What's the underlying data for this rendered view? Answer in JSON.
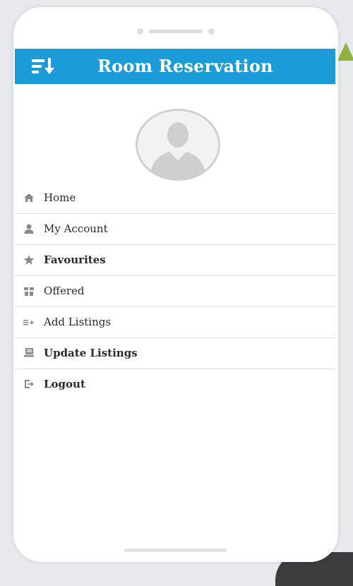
{
  "app": {
    "title": "Room Reservation",
    "accent_color": "#1b9bd8",
    "menu_icon": "sort-menu-icon",
    "avatar_icon": "user-avatar-placeholder"
  },
  "menu": {
    "items": [
      {
        "label": "Home",
        "icon": "home-icon"
      },
      {
        "label": "My Account",
        "icon": "user-icon"
      },
      {
        "label": "Favourites",
        "icon": "star-icon"
      },
      {
        "label": "Offered",
        "icon": "gift-icon"
      },
      {
        "label": "Add Listings",
        "icon": "list-add-icon"
      },
      {
        "label": "Update Listings",
        "icon": "update-icon"
      },
      {
        "label": "Logout",
        "icon": "logout-icon"
      }
    ]
  }
}
